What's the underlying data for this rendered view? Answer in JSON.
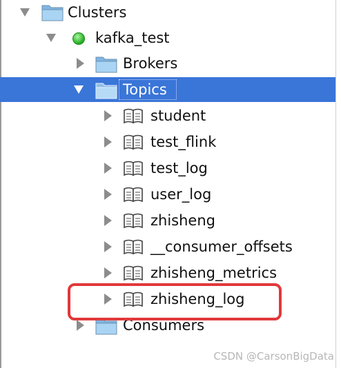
{
  "tree": {
    "clusters": {
      "label": "Clusters"
    },
    "cluster": {
      "label": "kafka_test",
      "status_color": "#2ec12e"
    },
    "brokers": {
      "label": "Brokers"
    },
    "topics": {
      "label": "Topics",
      "selected": true
    },
    "topic_items": [
      {
        "label": "student"
      },
      {
        "label": "test_flink"
      },
      {
        "label": "test_log"
      },
      {
        "label": "user_log"
      },
      {
        "label": "zhisheng"
      },
      {
        "label": "__consumer_offsets"
      },
      {
        "label": "zhisheng_metrics"
      },
      {
        "label": "zhisheng_log"
      }
    ],
    "consumers": {
      "label": "Consumers"
    }
  },
  "annotation": {
    "color": "#e1383a",
    "target": "zhisheng_log"
  },
  "watermark": "CSDN @CarsonBigData",
  "colors": {
    "selection": "#3a75d8",
    "folder": "#8ec4ec",
    "toggle": "#8c8c8c"
  },
  "icons": {
    "expanded": "triangle-down-icon",
    "collapsed": "triangle-right-icon",
    "folder": "folder-icon",
    "topic": "book-icon",
    "status": "green-dot-icon"
  }
}
